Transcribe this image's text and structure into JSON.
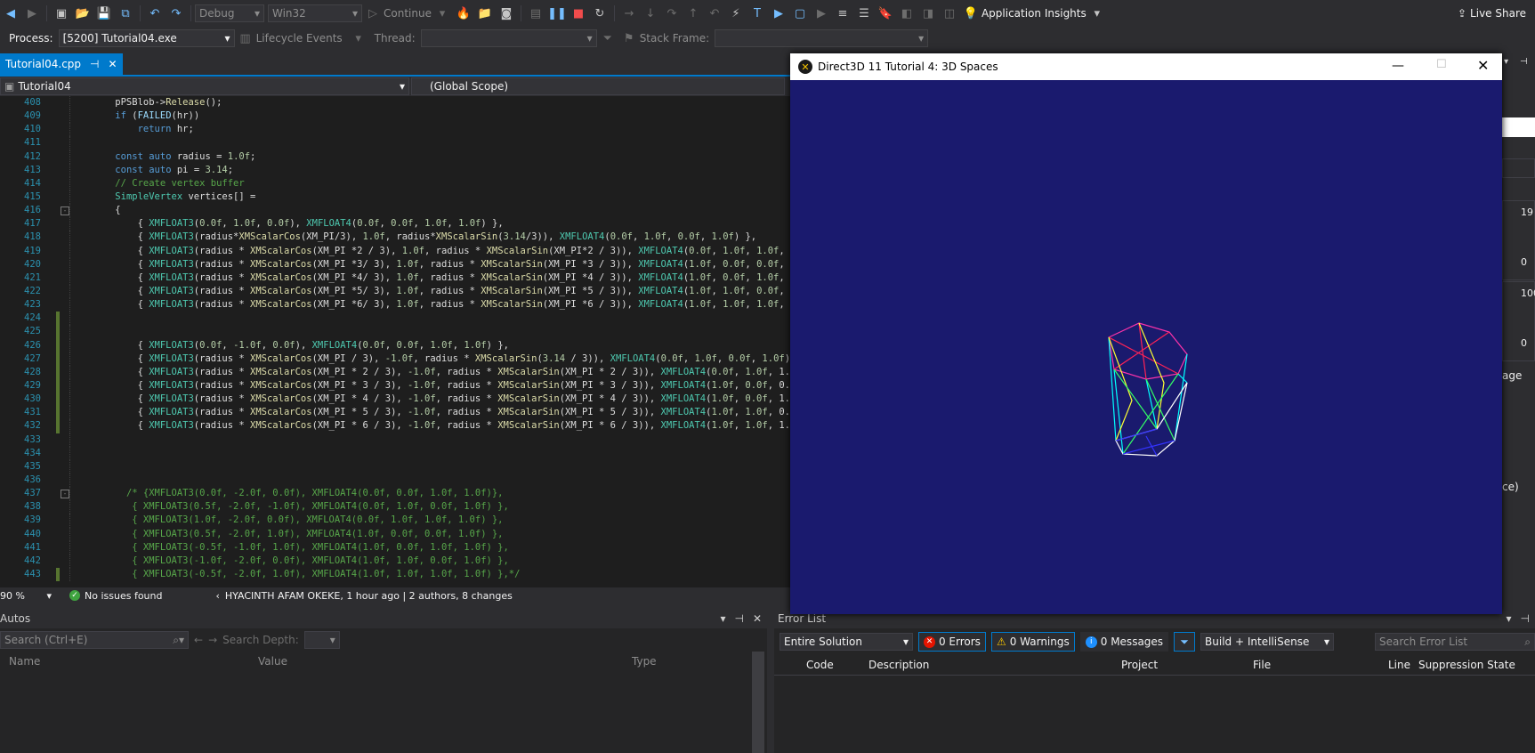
{
  "toolbar": {
    "config": "Debug",
    "platform": "Win32",
    "continue_label": "Continue",
    "app_insights": "Application Insights",
    "live_share": "Live Share"
  },
  "toolbar2": {
    "process_label": "Process:",
    "process_value": "[5200] Tutorial04.exe",
    "lifecycle": "Lifecycle Events",
    "thread_label": "Thread:",
    "stackframe_label": "Stack Frame:"
  },
  "tabs": [
    {
      "label": "Tutorial04.cpp"
    }
  ],
  "nav": {
    "project": "Tutorial04",
    "scope": "(Global Scope)"
  },
  "code_lines": [
    {
      "n": "408",
      "html": "    pPSBlob-&gt;<span class='t-fn'>Release</span>();"
    },
    {
      "n": "409",
      "html": "    <span class='t-kw'>if</span> (<span class='t-vr'>FAILED</span>(hr))"
    },
    {
      "n": "410",
      "html": "        <span class='t-kw'>return</span> hr;"
    },
    {
      "n": "411",
      "html": ""
    },
    {
      "n": "412",
      "html": "    <span class='t-kw'>const</span> <span class='t-kw'>auto</span> radius = <span class='t-nm'>1.0f</span>;"
    },
    {
      "n": "413",
      "html": "    <span class='t-kw'>const</span> <span class='t-kw'>auto</span> pi = <span class='t-nm'>3.14</span>;"
    },
    {
      "n": "414",
      "html": "    <span class='t-cm'>// Create vertex buffer</span>"
    },
    {
      "n": "415",
      "html": "    <span class='t-ty'>SimpleVertex</span> vertices[] ="
    },
    {
      "n": "416",
      "html": "    {"
    },
    {
      "n": "417",
      "html": "        { <span class='t-ty'>XMFLOAT3</span>(<span class='t-nm'>0.0f</span>, <span class='t-nm'>1.0f</span>, <span class='t-nm'>0.0f</span>), <span class='t-ty'>XMFLOAT4</span>(<span class='t-nm'>0.0f</span>, <span class='t-nm'>0.0f</span>, <span class='t-nm'>1.0f</span>, <span class='t-nm'>1.0f</span>) },"
    },
    {
      "n": "418",
      "html": "        { <span class='t-ty'>XMFLOAT3</span>(radius*<span class='t-fn'>XMScalarCos</span>(XM_PI/3), <span class='t-nm'>1.0f</span>, radius*<span class='t-fn'>XMScalarSin</span>(<span class='t-nm'>3.14</span>/3)), <span class='t-ty'>XMFLOAT4</span>(<span class='t-nm'>0.0f</span>, <span class='t-nm'>1.0f</span>, <span class='t-nm'>0.0f</span>, <span class='t-nm'>1.0f</span>) },"
    },
    {
      "n": "419",
      "html": "        { <span class='t-ty'>XMFLOAT3</span>(radius * <span class='t-fn'>XMScalarCos</span>(XM_PI *2 / 3), <span class='t-nm'>1.0f</span>, radius * <span class='t-fn'>XMScalarSin</span>(XM_PI*2 / 3)), <span class='t-ty'>XMFLOAT4</span>(<span class='t-nm'>0.0f</span>, <span class='t-nm'>1.0f</span>, <span class='t-nm'>1.0f</span>, 1."
    },
    {
      "n": "420",
      "html": "        { <span class='t-ty'>XMFLOAT3</span>(radius * <span class='t-fn'>XMScalarCos</span>(XM_PI *3/ 3), <span class='t-nm'>1.0f</span>, radius * <span class='t-fn'>XMScalarSin</span>(XM_PI *3 / 3)), <span class='t-ty'>XMFLOAT4</span>(<span class='t-nm'>1.0f</span>, <span class='t-nm'>0.0f</span>, <span class='t-nm'>0.0f</span>, 1."
    },
    {
      "n": "421",
      "html": "        { <span class='t-ty'>XMFLOAT3</span>(radius * <span class='t-fn'>XMScalarCos</span>(XM_PI *4/ 3), <span class='t-nm'>1.0f</span>, radius * <span class='t-fn'>XMScalarSin</span>(XM_PI *4 / 3)), <span class='t-ty'>XMFLOAT4</span>(<span class='t-nm'>1.0f</span>, <span class='t-nm'>0.0f</span>, <span class='t-nm'>1.0f</span>, 1."
    },
    {
      "n": "422",
      "html": "        { <span class='t-ty'>XMFLOAT3</span>(radius * <span class='t-fn'>XMScalarCos</span>(XM_PI *5/ 3), <span class='t-nm'>1.0f</span>, radius * <span class='t-fn'>XMScalarSin</span>(XM_PI *5 / 3)), <span class='t-ty'>XMFLOAT4</span>(<span class='t-nm'>1.0f</span>, <span class='t-nm'>1.0f</span>, <span class='t-nm'>0.0f</span>, 1."
    },
    {
      "n": "423",
      "html": "        { <span class='t-ty'>XMFLOAT3</span>(radius * <span class='t-fn'>XMScalarCos</span>(XM_PI *6/ 3), <span class='t-nm'>1.0f</span>, radius * <span class='t-fn'>XMScalarSin</span>(XM_PI *6 / 3)), <span class='t-ty'>XMFLOAT4</span>(<span class='t-nm'>1.0f</span>, <span class='t-nm'>1.0f</span>, <span class='t-nm'>1.0f</span>, 1."
    },
    {
      "n": "424",
      "html": ""
    },
    {
      "n": "425",
      "html": ""
    },
    {
      "n": "426",
      "html": "        { <span class='t-ty'>XMFLOAT3</span>(<span class='t-nm'>0.0f</span>, <span class='t-nm'>-1.0f</span>, <span class='t-nm'>0.0f</span>), <span class='t-ty'>XMFLOAT4</span>(<span class='t-nm'>0.0f</span>, <span class='t-nm'>0.0f</span>, <span class='t-nm'>1.0f</span>, <span class='t-nm'>1.0f</span>) },"
    },
    {
      "n": "427",
      "html": "        { <span class='t-ty'>XMFLOAT3</span>(radius * <span class='t-fn'>XMScalarCos</span>(XM_PI / 3), <span class='t-nm'>-1.0f</span>, radius * <span class='t-fn'>XMScalarSin</span>(<span class='t-nm'>3.14</span> / 3)), <span class='t-ty'>XMFLOAT4</span>(<span class='t-nm'>0.0f</span>, <span class='t-nm'>1.0f</span>, <span class='t-nm'>0.0f</span>, <span class='t-nm'>1.0f</span>) }"
    },
    {
      "n": "428",
      "html": "        { <span class='t-ty'>XMFLOAT3</span>(radius * <span class='t-fn'>XMScalarCos</span>(XM_PI * 2 / 3), <span class='t-nm'>-1.0f</span>, radius * <span class='t-fn'>XMScalarSin</span>(XM_PI * 2 / 3)), <span class='t-ty'>XMFLOAT4</span>(<span class='t-nm'>0.0f</span>, <span class='t-nm'>1.0f</span>, 1.0f"
    },
    {
      "n": "429",
      "html": "        { <span class='t-ty'>XMFLOAT3</span>(radius * <span class='t-fn'>XMScalarCos</span>(XM_PI * 3 / 3), <span class='t-nm'>-1.0f</span>, radius * <span class='t-fn'>XMScalarSin</span>(XM_PI * 3 / 3)), <span class='t-ty'>XMFLOAT4</span>(<span class='t-nm'>1.0f</span>, <span class='t-nm'>0.0f</span>, 0.0f"
    },
    {
      "n": "430",
      "html": "        { <span class='t-ty'>XMFLOAT3</span>(radius * <span class='t-fn'>XMScalarCos</span>(XM_PI * 4 / 3), <span class='t-nm'>-1.0f</span>, radius * <span class='t-fn'>XMScalarSin</span>(XM_PI * 4 / 3)), <span class='t-ty'>XMFLOAT4</span>(<span class='t-nm'>1.0f</span>, <span class='t-nm'>0.0f</span>, 1.0f"
    },
    {
      "n": "431",
      "html": "        { <span class='t-ty'>XMFLOAT3</span>(radius * <span class='t-fn'>XMScalarCos</span>(XM_PI * 5 / 3), <span class='t-nm'>-1.0f</span>, radius * <span class='t-fn'>XMScalarSin</span>(XM_PI * 5 / 3)), <span class='t-ty'>XMFLOAT4</span>(<span class='t-nm'>1.0f</span>, <span class='t-nm'>1.0f</span>, 0.0f"
    },
    {
      "n": "432",
      "html": "        { <span class='t-ty'>XMFLOAT3</span>(radius * <span class='t-fn'>XMScalarCos</span>(XM_PI * 6 / 3), <span class='t-nm'>-1.0f</span>, radius * <span class='t-fn'>XMScalarSin</span>(XM_PI * 6 / 3)), <span class='t-ty'>XMFLOAT4</span>(<span class='t-nm'>1.0f</span>, <span class='t-nm'>1.0f</span>, 1.0f"
    },
    {
      "n": "433",
      "html": ""
    },
    {
      "n": "434",
      "html": ""
    },
    {
      "n": "435",
      "html": ""
    },
    {
      "n": "436",
      "html": ""
    },
    {
      "n": "437",
      "html": "      <span class='t-cm'>/* {XMFLOAT3(0.0f, -2.0f, 0.0f), XMFLOAT4(0.0f, 0.0f, 1.0f, 1.0f)},</span>"
    },
    {
      "n": "438",
      "html": "       <span class='t-cm'>{ XMFLOAT3(0.5f, -2.0f, -1.0f), XMFLOAT4(0.0f, 1.0f, 0.0f, 1.0f) },</span>"
    },
    {
      "n": "439",
      "html": "       <span class='t-cm'>{ XMFLOAT3(1.0f, -2.0f, 0.0f), XMFLOAT4(0.0f, 1.0f, 1.0f, 1.0f) },</span>"
    },
    {
      "n": "440",
      "html": "       <span class='t-cm'>{ XMFLOAT3(0.5f, -2.0f, 1.0f), XMFLOAT4(1.0f, 0.0f, 0.0f, 1.0f) },</span>"
    },
    {
      "n": "441",
      "html": "       <span class='t-cm'>{ XMFLOAT3(-0.5f, -1.0f, 1.0f), XMFLOAT4(1.0f, 0.0f, 1.0f, 1.0f) },</span>"
    },
    {
      "n": "442",
      "html": "       <span class='t-cm'>{ XMFLOAT3(-1.0f, -2.0f, 0.0f), XMFLOAT4(1.0f, 1.0f, 0.0f, 1.0f) },</span>"
    },
    {
      "n": "443",
      "html": "       <span class='t-cm'>{ XMFLOAT3(-0.5f, -2.0f, 1.0f), XMFLOAT4(1.0f, 1.0f, 1.0f, 1.0f) },*/</span>"
    }
  ],
  "editor_status": {
    "zoom": "90 %",
    "issues": "No issues found",
    "git_info": "HYACINTH AFAM OKEKE, 1 hour ago | 2 authors, 8 changes"
  },
  "autos": {
    "title": "Autos",
    "search_placeholder": "Search (Ctrl+E)",
    "search_depth_label": "Search Depth:",
    "columns": [
      "Name",
      "Value",
      "Type"
    ]
  },
  "error_list": {
    "title": "Error List",
    "scope": "Entire Solution",
    "errors": "0 Errors",
    "warnings": "0 Warnings",
    "messages": "0 Messages",
    "build_filter": "Build + IntelliSense",
    "search_placeholder": "Search Error List",
    "columns": [
      "Code",
      "Description",
      "Project",
      "File",
      "Line",
      "Suppression State"
    ]
  },
  "right_panel": {
    "values": [
      "19",
      "0",
      "100",
      "0"
    ],
    "fragments": [
      "age",
      "ce)"
    ]
  },
  "d3d_window": {
    "title": "Direct3D 11 Tutorial 4: 3D Spaces",
    "bg_color": "#1a1a6e"
  },
  "colors": {
    "accent": "#007acc",
    "editor_bg": "#1e1e1e",
    "chrome_bg": "#2d2d30"
  }
}
